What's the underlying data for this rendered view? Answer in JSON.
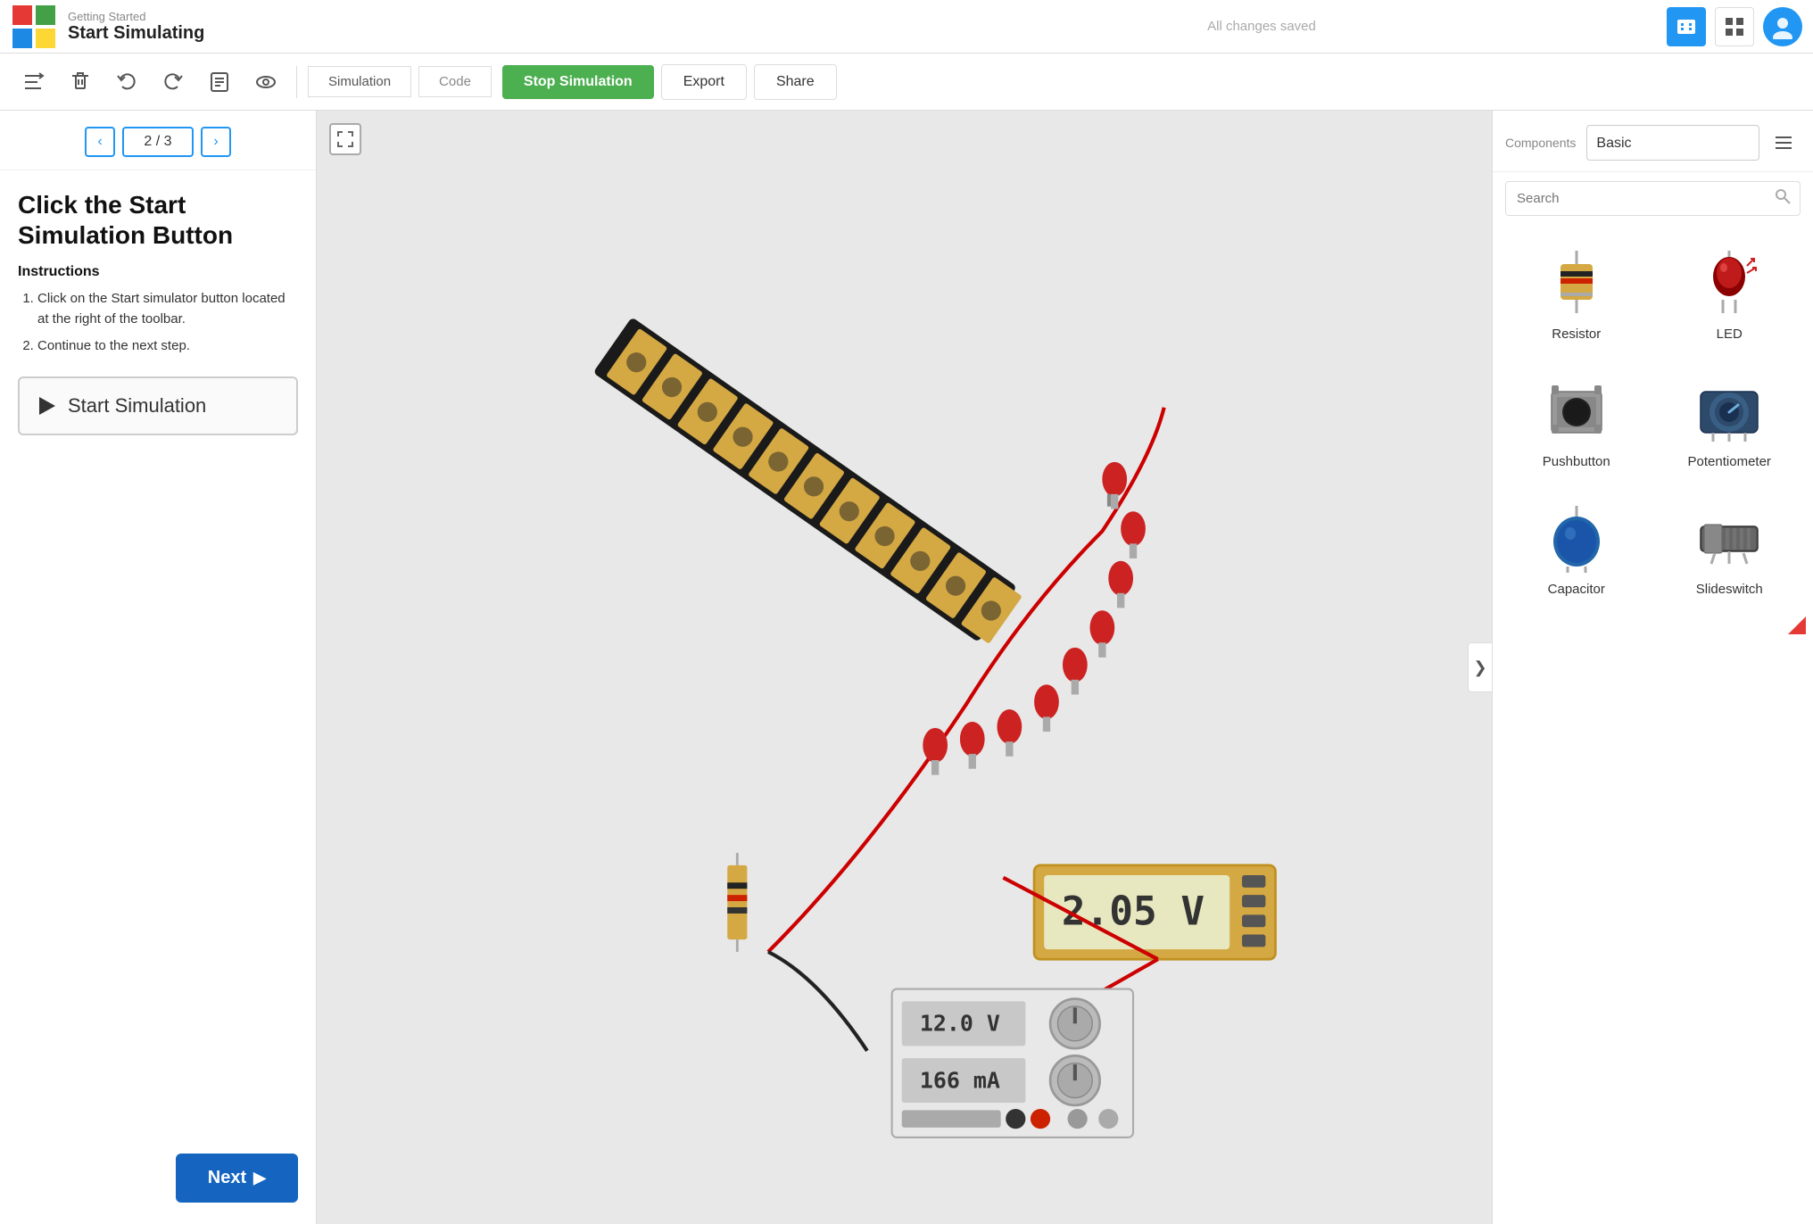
{
  "topbar": {
    "subtitle": "Getting Started",
    "title": "Start Simulating",
    "saved_text": "All changes saved",
    "export_label": "Export",
    "share_label": "Share"
  },
  "toolbar": {
    "tab_simulate": "Simulation",
    "tab_code": "Code",
    "stop_btn": "Stop Simulation",
    "export_btn": "Export",
    "share_btn": "Share"
  },
  "sidebar": {
    "pager": "2 / 3",
    "heading": "Click the Start Simulation Button",
    "instructions_label": "Instructions",
    "instructions": [
      "Click on the Start simulator button located at the right of the toolbar.",
      "Continue to the next step."
    ],
    "start_sim_label": "Start Simulation",
    "next_label": "Next"
  },
  "components": {
    "title": "Components",
    "category": "Basic",
    "search_placeholder": "Search",
    "items": [
      {
        "name": "Resistor"
      },
      {
        "name": "LED"
      },
      {
        "name": "Pushbutton"
      },
      {
        "name": "Potentiometer"
      },
      {
        "name": "Capacitor"
      },
      {
        "name": "Slideswitch"
      }
    ]
  },
  "canvas": {
    "voltage_display": "2.05 V",
    "voltage_top": "12.0 V",
    "current": "166 mA"
  }
}
